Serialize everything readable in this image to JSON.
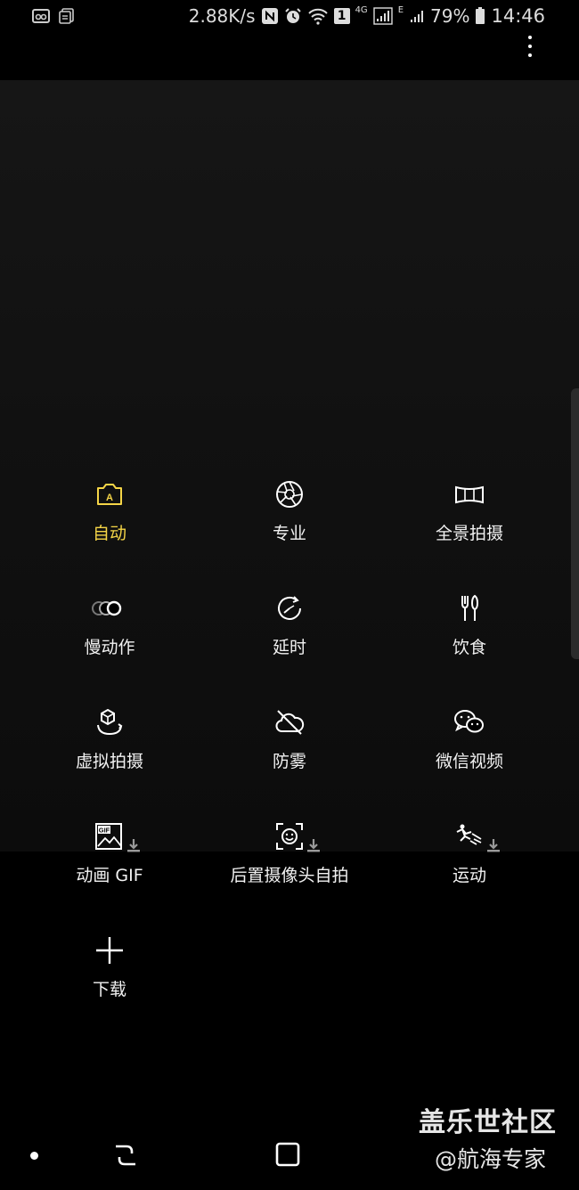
{
  "status_bar": {
    "network_speed": "2.88K/s",
    "net_type_1": "4G",
    "net_type_2": "E",
    "sim_badge": "1",
    "battery": "79%",
    "time": "14:46"
  },
  "modes": [
    {
      "label": "自动",
      "icon": "camera-auto-icon",
      "active": true
    },
    {
      "label": "专业",
      "icon": "aperture-icon",
      "active": false
    },
    {
      "label": "全景拍摄",
      "icon": "panorama-icon",
      "active": false
    },
    {
      "label": "慢动作",
      "icon": "slow-motion-icon",
      "active": false
    },
    {
      "label": "延时",
      "icon": "hyperlapse-icon",
      "active": false
    },
    {
      "label": "饮食",
      "icon": "food-icon",
      "active": false
    },
    {
      "label": "虚拟拍摄",
      "icon": "virtual-shot-icon",
      "active": false
    },
    {
      "label": "防雾",
      "icon": "anti-fog-icon",
      "active": false
    },
    {
      "label": "微信视频",
      "icon": "wechat-icon",
      "active": false
    },
    {
      "label": "动画 GIF",
      "icon": "gif-icon",
      "active": false,
      "download": true
    },
    {
      "label": "后置摄像头自拍",
      "icon": "rear-selfie-icon",
      "active": false,
      "download": true
    },
    {
      "label": "运动",
      "icon": "sports-icon",
      "active": false,
      "download": true
    },
    {
      "label": "下载",
      "icon": "plus-icon",
      "active": false
    }
  ],
  "colors": {
    "accent": "#f5d547",
    "background": "#000000"
  },
  "watermark": {
    "line1": "盖乐世社区",
    "line2": "@航海专家"
  }
}
